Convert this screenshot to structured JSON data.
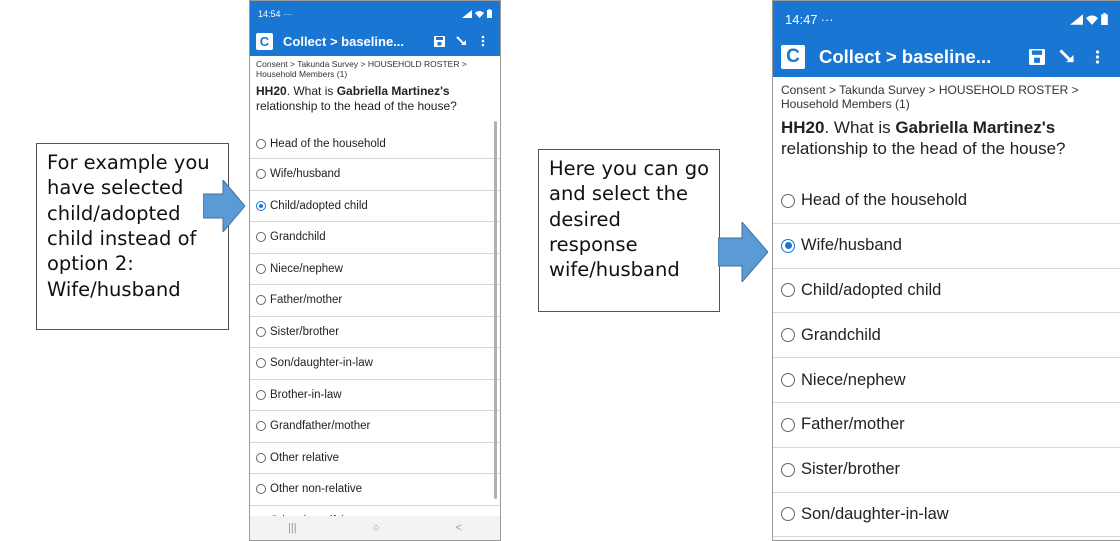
{
  "callouts": {
    "left": "For example you have selected child/adopted child instead of option 2: Wife/husband",
    "right": "Here you can go and select the desired response wife/husband"
  },
  "phone_before": {
    "status_time": "14:54",
    "status_extra": "···",
    "app_title": "Collect > baseline...",
    "breadcrumb": "Consent > Takunda Survey > HOUSEHOLD ROSTER > Household Members (1)",
    "question_code": "HH20",
    "question_pre": ". What is ",
    "question_name": "Gabriella Martinez's",
    "question_post": " relationship to the head of the house?",
    "options": [
      {
        "label": "Head of the household",
        "selected": false
      },
      {
        "label": "Wife/husband",
        "selected": false
      },
      {
        "label": "Child/adopted child",
        "selected": true
      },
      {
        "label": "Grandchild",
        "selected": false
      },
      {
        "label": "Niece/nephew",
        "selected": false
      },
      {
        "label": "Father/mother",
        "selected": false
      },
      {
        "label": "Sister/brother",
        "selected": false
      },
      {
        "label": "Son/daughter-in-law",
        "selected": false
      },
      {
        "label": "Brother-in-law",
        "selected": false
      },
      {
        "label": "Grandfather/mother",
        "selected": false
      },
      {
        "label": "Other relative",
        "selected": false
      },
      {
        "label": "Other non-relative",
        "selected": false
      },
      {
        "label": "Other (specify)",
        "selected": false
      }
    ],
    "nav": [
      "|||",
      "○",
      "<"
    ]
  },
  "phone_after": {
    "status_time": "14:47",
    "status_extra": "···",
    "app_title": "Collect > baseline...",
    "breadcrumb": "Consent > Takunda Survey > HOUSEHOLD ROSTER > Household Members (1)",
    "question_code": "HH20",
    "question_pre": ". What is ",
    "question_name": "Gabriella Martinez's",
    "question_post": " relationship to the head of the house?",
    "options": [
      {
        "label": "Head of the household",
        "selected": false
      },
      {
        "label": "Wife/husband",
        "selected": true
      },
      {
        "label": "Child/adopted child",
        "selected": false
      },
      {
        "label": "Grandchild",
        "selected": false
      },
      {
        "label": "Niece/nephew",
        "selected": false
      },
      {
        "label": "Father/mother",
        "selected": false
      },
      {
        "label": "Sister/brother",
        "selected": false
      },
      {
        "label": "Son/daughter-in-law",
        "selected": false
      }
    ]
  },
  "colors": {
    "accent": "#1976d2",
    "arrow": "#5b9bd5"
  },
  "icons": [
    "save-icon",
    "signal-icon",
    "more-icon",
    "wifi-icon",
    "battery-icon"
  ]
}
